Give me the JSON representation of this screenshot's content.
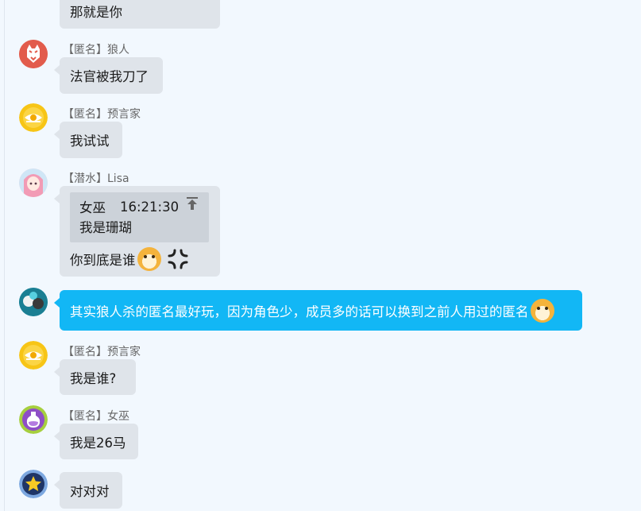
{
  "messages": [
    {
      "sender": "",
      "text": "那就是你"
    },
    {
      "sender": "【匿名】狼人",
      "text": "法官被我刀了"
    },
    {
      "sender": "【匿名】预言家",
      "text": "我试试"
    },
    {
      "sender": "【潜水】Lisa",
      "quote": {
        "author": "女巫",
        "time": "16:21:30",
        "text": "我是珊瑚"
      },
      "text": "你到底是谁",
      "emoji": "doge-emoji",
      "sticker": "anger-icon"
    },
    {
      "sender": "",
      "text": "其实狼人杀的匿名最好玩，因为角色少，成员多的话可以换到之前人用过的匿名",
      "emoji": "doge-emoji",
      "own": true
    },
    {
      "sender": "【匿名】预言家",
      "text": "我是谁?"
    },
    {
      "sender": "【匿名】女巫",
      "text": "我是26马"
    },
    {
      "sender": "",
      "text": "对对对"
    }
  ],
  "colors": {
    "bubble": "#dfe4ea",
    "own_bubble": "#12b7f5",
    "background": "#f2f8fe"
  }
}
